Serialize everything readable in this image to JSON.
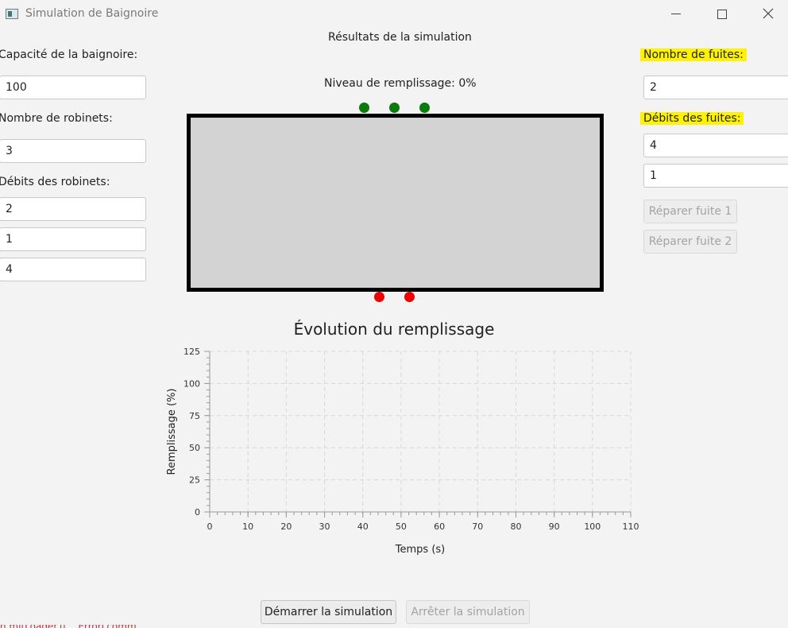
{
  "window": {
    "title": "Simulation de Baignoire"
  },
  "left": {
    "capacity_label": "Capacité de la baignoire:",
    "capacity_value": "100",
    "taps_count_label": "Nombre de robinets:",
    "taps_count_value": "3",
    "tap_rates_label": "Débits des robinets:",
    "tap_rates": [
      "2",
      "1",
      "4"
    ]
  },
  "center": {
    "results_title": "Résultats de la simulation",
    "fill_level": "Niveau de remplissage: 0%",
    "taps_count": 3,
    "leaks_count": 2,
    "fill_fraction": 0
  },
  "right": {
    "leaks_count_label": "Nombre de fuites:",
    "leaks_count_value": "2",
    "leak_rates_label": "Débits des fuites:",
    "leak_rates": [
      "4",
      "1"
    ],
    "repair_buttons": [
      "Réparer fuite 1",
      "Réparer fuite 2"
    ]
  },
  "chart_data": {
    "type": "line",
    "title": "Évolution du remplissage",
    "xlabel": "Temps (s)",
    "ylabel": "Remplissage (%)",
    "xlim": [
      0,
      110
    ],
    "ylim": [
      0,
      125
    ],
    "x_ticks": [
      0,
      10,
      20,
      30,
      40,
      50,
      60,
      70,
      80,
      90,
      100,
      110
    ],
    "y_ticks": [
      0,
      25,
      50,
      75,
      100,
      125
    ],
    "grid": true,
    "series": [
      {
        "values": []
      }
    ]
  },
  "footer": {
    "start_label": "Démarrer la simulation",
    "stop_label": "Arrêter la simulation",
    "stray_text": "n.mitLoader.u… ErrorLcomm ..."
  },
  "colors": {
    "tap": "#0a7a0a",
    "leak": "#ee0000",
    "highlight": "#fff200",
    "tub_fill": "#d3d3d3"
  }
}
